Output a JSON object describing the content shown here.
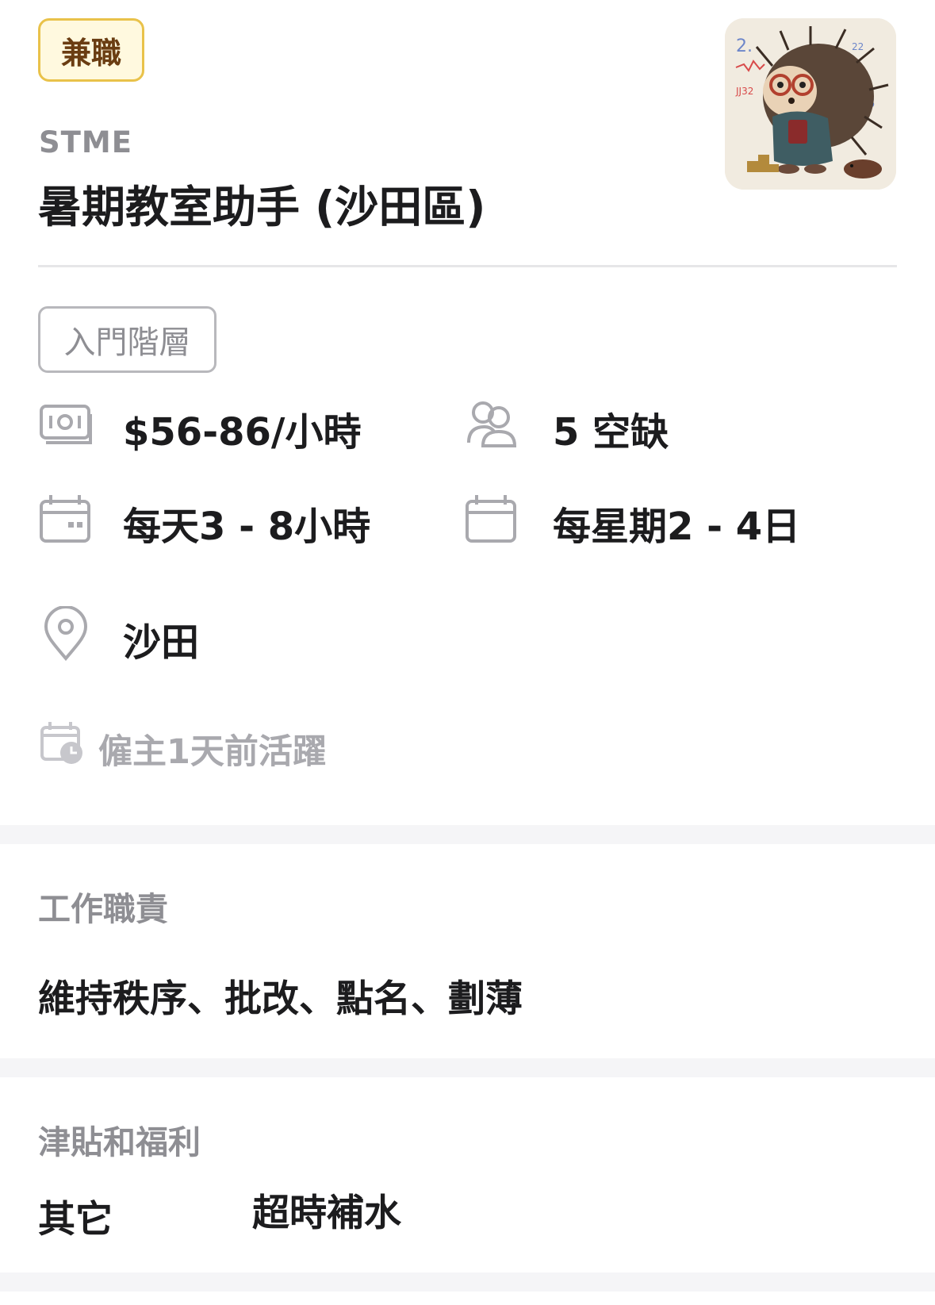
{
  "job": {
    "type_badge": "兼職",
    "company": "STME",
    "title": "暑期教室助手 (沙田區)",
    "level": "入門階層"
  },
  "details": {
    "salary": "$56-86/小時",
    "vacancies": "5 空缺",
    "hours_per_day": "每天3 - 8小時",
    "days_per_week": "每星期2 - 4日",
    "location": "沙田",
    "employer_active": "僱主1天前活躍"
  },
  "icons": {
    "salary": "cash-icon",
    "vacancies": "people-icon",
    "hours": "calendar-hours-icon",
    "days": "calendar-icon",
    "location": "location-pin-icon",
    "active": "calendar-clock-icon"
  },
  "duties": {
    "label": "工作職責",
    "text": "維持秩序、批改、點名、劃薄"
  },
  "benefits": {
    "label": "津貼和福利",
    "category": "其它",
    "item": "超時補水"
  },
  "colors": {
    "badge_border": "#e9c24a",
    "badge_bg": "#fff9df",
    "badge_text": "#6a3d12",
    "muted_text": "#8e8e93",
    "icon_gray": "#a9a9ae"
  }
}
